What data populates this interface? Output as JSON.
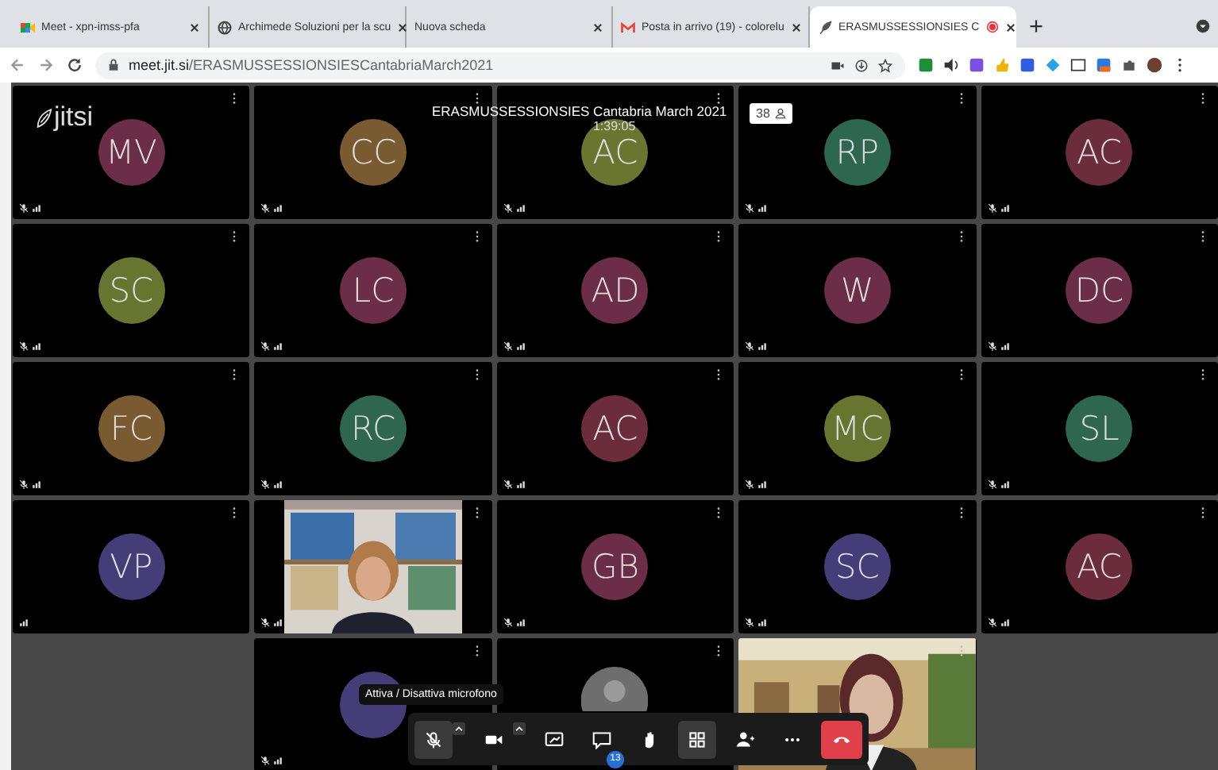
{
  "browser": {
    "tabs": [
      {
        "title": "Meet - xpn-imss-pfa",
        "kind": "meet",
        "selected": false
      },
      {
        "title": "Archimede Soluzioni per la scu",
        "kind": "globe",
        "selected": false
      },
      {
        "title": "Nuova scheda",
        "kind": "plain",
        "selected": false
      },
      {
        "title": "Posta in arrivo (19) - colorelu",
        "kind": "mail",
        "selected": false
      },
      {
        "title": "ERASMUSSESSIONSIES C",
        "kind": "feather",
        "selected": true
      }
    ],
    "url_host": "meet.jit.si",
    "url_path": "/ERASMUSSESSIONSIESCantabriaMarch2021"
  },
  "meeting": {
    "logo": "jitsi",
    "title": "ERASMUSSESSIONSIES Cantabria March 2021",
    "timer": "1:39:05",
    "participants": "38"
  },
  "tiles": [
    {
      "kind": "avatar",
      "initials": "MV",
      "color": "#6b2d47",
      "muted": true
    },
    {
      "kind": "avatar",
      "initials": "CC",
      "color": "#7a5a30",
      "muted": true
    },
    {
      "kind": "avatar",
      "initials": "AC",
      "color": "#6a7530",
      "muted": true
    },
    {
      "kind": "avatar",
      "initials": "RP",
      "color": "#2f6650",
      "muted": true
    },
    {
      "kind": "avatar",
      "initials": "AC",
      "color": "#6b2d3c",
      "muted": true
    },
    {
      "kind": "avatar",
      "initials": "SC",
      "color": "#687530",
      "muted": true
    },
    {
      "kind": "avatar",
      "initials": "LC",
      "color": "#6b2d47",
      "muted": true
    },
    {
      "kind": "avatar",
      "initials": "AD",
      "color": "#6b2d47",
      "muted": true
    },
    {
      "kind": "avatar",
      "initials": "W",
      "color": "#6b2d47",
      "muted": true
    },
    {
      "kind": "avatar",
      "initials": "DC",
      "color": "#6b2d47",
      "muted": true
    },
    {
      "kind": "avatar",
      "initials": "FC",
      "color": "#7a5a30",
      "muted": true
    },
    {
      "kind": "avatar",
      "initials": "RC",
      "color": "#2f6650",
      "muted": true
    },
    {
      "kind": "avatar",
      "initials": "AC",
      "color": "#6b2d3c",
      "muted": true
    },
    {
      "kind": "avatar",
      "initials": "MC",
      "color": "#687530",
      "muted": true
    },
    {
      "kind": "avatar",
      "initials": "SL",
      "color": "#2f6650",
      "muted": true
    },
    {
      "kind": "avatar",
      "initials": "VP",
      "color": "#453d78",
      "muted": false
    },
    {
      "kind": "video",
      "muted": true
    },
    {
      "kind": "avatar",
      "initials": "GB",
      "color": "#6b2d47",
      "muted": true
    },
    {
      "kind": "avatar",
      "initials": "SC",
      "color": "#453d78",
      "muted": true
    },
    {
      "kind": "avatar",
      "initials": "AC",
      "color": "#6b2d3c",
      "muted": true
    },
    {
      "kind": "empty"
    },
    {
      "kind": "avatar",
      "color": "#453d78",
      "muted": true
    },
    {
      "kind": "placeholder"
    },
    {
      "kind": "video_full"
    },
    {
      "kind": "empty"
    }
  ],
  "tooltip": "Attiva / Disattiva microfono",
  "toolbar": [
    {
      "kind": "mic",
      "selected": true
    },
    {
      "kind": "camera",
      "selected": false
    },
    {
      "kind": "share",
      "selected": false
    },
    {
      "kind": "chat",
      "selected": false,
      "badge": "13"
    },
    {
      "kind": "hand",
      "selected": false
    },
    {
      "kind": "tiles",
      "selected": true
    },
    {
      "kind": "invite",
      "selected": false
    },
    {
      "kind": "more",
      "selected": false
    },
    {
      "kind": "hangup"
    }
  ]
}
